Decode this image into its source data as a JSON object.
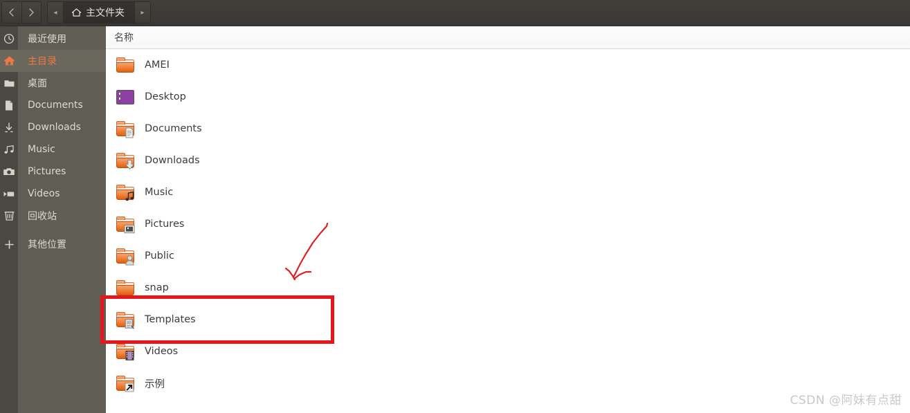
{
  "header": {
    "nav": {
      "back_label": "‹",
      "forward_label": "›",
      "back_name": "back-button",
      "forward_name": "forward-button"
    },
    "pathbar": {
      "left_arrow": "◂",
      "right_arrow": "▸",
      "current": "主文件夹",
      "icon": "home-icon"
    }
  },
  "sidebar": {
    "items": [
      {
        "label": "最近使用",
        "icon": "clock-icon",
        "active": false
      },
      {
        "label": "主目录",
        "icon": "home-icon",
        "active": true
      },
      {
        "label": "桌面",
        "icon": "folder-icon",
        "active": false
      },
      {
        "label": "Documents",
        "icon": "document-icon",
        "active": false
      },
      {
        "label": "Downloads",
        "icon": "download-icon",
        "active": false
      },
      {
        "label": "Music",
        "icon": "music-icon",
        "active": false
      },
      {
        "label": "Pictures",
        "icon": "camera-icon",
        "active": false
      },
      {
        "label": "Videos",
        "icon": "video-icon",
        "active": false
      },
      {
        "label": "回收站",
        "icon": "trash-icon",
        "active": false
      },
      {
        "label": "其他位置",
        "icon": "plus-icon",
        "active": false
      }
    ]
  },
  "filelist": {
    "column_header": "名称",
    "rows": [
      {
        "name": "AMEI",
        "icon": "folder-icon"
      },
      {
        "name": "Desktop",
        "icon": "desktop-folder-icon"
      },
      {
        "name": "Documents",
        "icon": "documents-folder-icon"
      },
      {
        "name": "Downloads",
        "icon": "downloads-folder-icon"
      },
      {
        "name": "Music",
        "icon": "music-folder-icon"
      },
      {
        "name": "Pictures",
        "icon": "pictures-folder-icon"
      },
      {
        "name": "Public",
        "icon": "public-folder-icon"
      },
      {
        "name": "snap",
        "icon": "folder-icon"
      },
      {
        "name": "Templates",
        "icon": "templates-folder-icon"
      },
      {
        "name": "Videos",
        "icon": "videos-folder-icon"
      },
      {
        "name": "示例",
        "icon": "shortcut-folder-icon"
      }
    ],
    "highlighted_row": "Templates"
  },
  "annotations": {
    "highlight_color": "#e8161c",
    "arrow_color": "#e02020",
    "watermark": "CSDN @阿妹有点甜"
  }
}
